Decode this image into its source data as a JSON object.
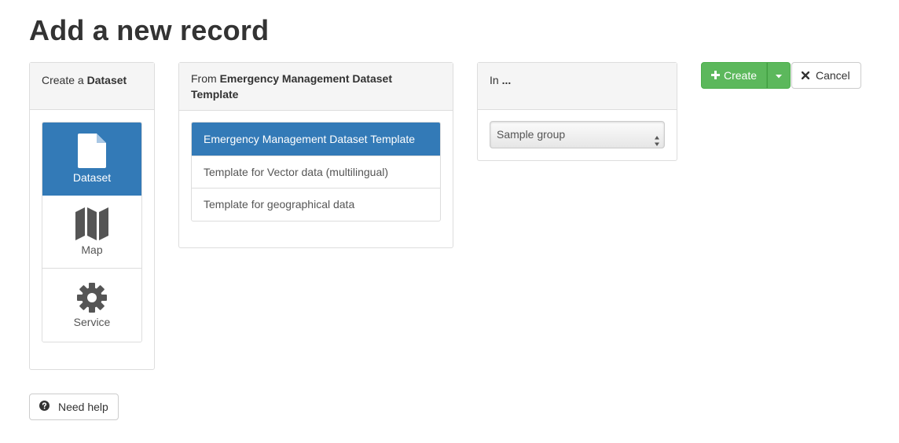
{
  "page": {
    "title": "Add a new record"
  },
  "type_panel": {
    "heading_prefix": "Create a",
    "heading_bold": "Dataset",
    "items": [
      {
        "label": "Dataset",
        "icon": "file-icon",
        "active": true
      },
      {
        "label": "Map",
        "icon": "map-icon",
        "active": false
      },
      {
        "label": "Service",
        "icon": "gear-icon",
        "active": false
      }
    ]
  },
  "template_panel": {
    "heading_prefix": "From",
    "heading_bold_line1": "Emergency Management Dataset",
    "heading_bold_line2": "Template",
    "items": [
      {
        "label": "Emergency Management Dataset Template",
        "active": true
      },
      {
        "label": "Template for Vector data (multilingual)",
        "active": false
      },
      {
        "label": "Template for geographical data",
        "active": false
      }
    ]
  },
  "group_panel": {
    "heading_prefix": "In",
    "heading_bold": "...",
    "select_value": "Sample group"
  },
  "actions": {
    "create_label": "Create",
    "cancel_label": "Cancel",
    "help_label": "Need help"
  },
  "colors": {
    "primary": "#337ab7",
    "success": "#5cb85c",
    "panel_heading_bg": "#f5f5f5",
    "border": "#dddddd"
  }
}
